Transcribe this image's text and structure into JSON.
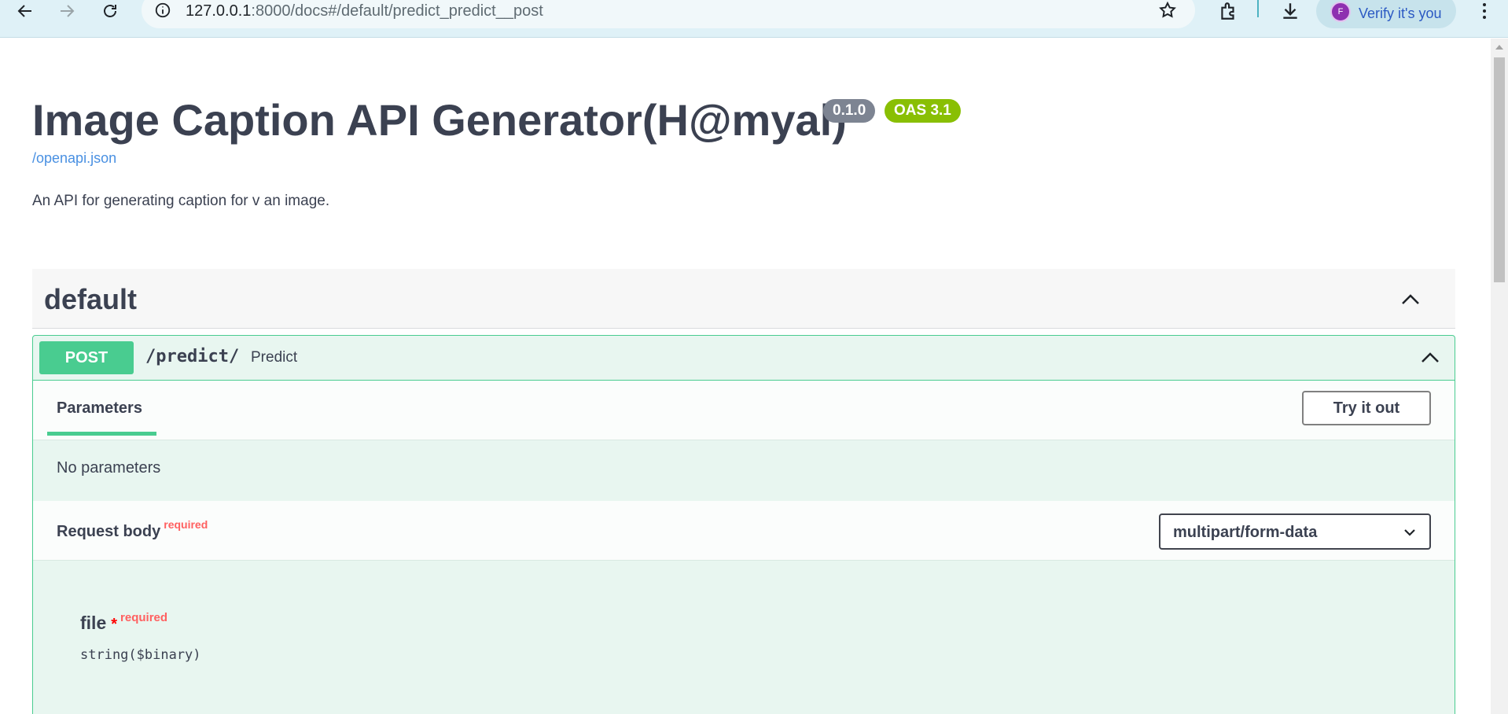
{
  "browser": {
    "url_host": "127.0.0.1",
    "url_path": ":8000/docs#/default/predict_predict__post",
    "profile_initial": "F",
    "profile_label": "Verify it's you",
    "profile_color": "#8e2fb0"
  },
  "page": {
    "title": "Image Caption API Generator(H@myal)",
    "version_badge": "0.1.0",
    "oas_badge": "OAS 3.1",
    "openapi_link": "/openapi.json",
    "description": "An API for generating caption for v an image."
  },
  "tag": {
    "name": "default"
  },
  "operation": {
    "method": "POST",
    "path": "/predict/",
    "summary": "Predict",
    "parameters_tab": "Parameters",
    "try_button": "Try it out",
    "no_parameters": "No parameters",
    "request_body_label": "Request body",
    "request_body_required": "required",
    "content_type": "multipart/form-data",
    "field": {
      "name": "file",
      "required_marker": "*",
      "required_text": "required",
      "type": "string($binary)"
    }
  },
  "colors": {
    "post_green": "#49cc90",
    "opblock_bg": "#e8f6f0",
    "link_blue": "#4990e2",
    "required_red": "#ff6060",
    "oas_green": "#89bf04",
    "version_gray": "#7d8492"
  }
}
